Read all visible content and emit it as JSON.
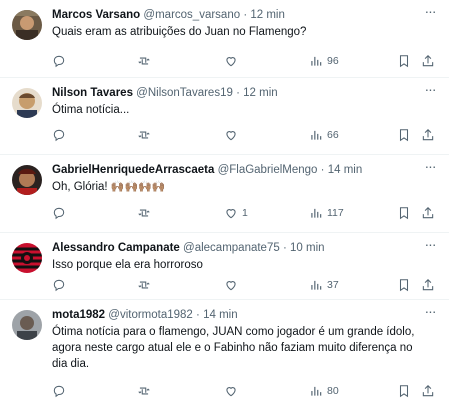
{
  "tweets": [
    {
      "name": "Marcos Varsano",
      "handle": "@marcos_varsano",
      "dot": "·",
      "time": "12 min",
      "text": "Quais eram as atribuições do Juan no Flamengo?",
      "replies": "",
      "likes": "",
      "views": "96"
    },
    {
      "name": "Nilson Tavares",
      "handle": "@NilsonTavares19",
      "dot": "·",
      "time": "12 min",
      "text": "Ótima notícia...",
      "replies": "",
      "likes": "",
      "views": "66"
    },
    {
      "name": "GabrielHenriquedeArrascaeta",
      "handle": "@FlaGabrielMengo",
      "dot": "·",
      "time": "14 min",
      "text": "Oh, Glória!",
      "emoji": "🙌🏽🙌🏽🙌🏽🙌🏽",
      "replies": "",
      "likes": "1",
      "views": "117"
    },
    {
      "name": "Alessandro Campanate",
      "handle": "@alecampanate75",
      "dot": "·",
      "time": "10 min",
      "text": "Isso porque ela era horroroso",
      "replies": "",
      "likes": "",
      "views": "37"
    },
    {
      "name": "mota1982",
      "handle": "@vitormota1982",
      "dot": "·",
      "time": "14 min",
      "text": "Ótima notícia para o flamengo, JUAN como jogador é um grande ídolo, agora neste cargo atual ele e o Fabinho não faziam muito diferença no dia dia.",
      "replies": "",
      "likes": "",
      "views": "80"
    }
  ],
  "colors": {
    "text": "#0f1419",
    "secondary": "#536471",
    "divider": "#eff3f4"
  },
  "icons": [
    "more-icon",
    "reply-icon",
    "retweet-icon",
    "like-icon",
    "views-icon",
    "bookmark-icon",
    "share-icon"
  ]
}
